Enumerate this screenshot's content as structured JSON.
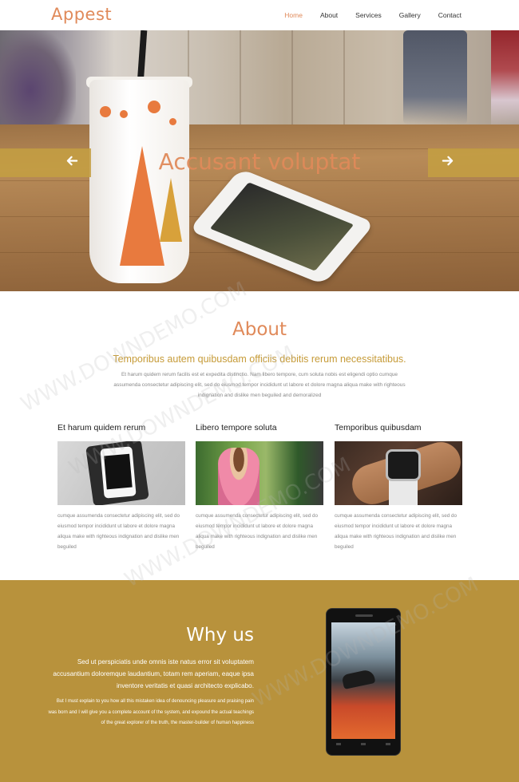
{
  "header": {
    "logo": "Appest",
    "nav": [
      {
        "label": "Home",
        "active": true
      },
      {
        "label": "About",
        "active": false
      },
      {
        "label": "Services",
        "active": false
      },
      {
        "label": "Gallery",
        "active": false
      },
      {
        "label": "Contact",
        "active": false
      }
    ]
  },
  "hero": {
    "title": "Accusant voluptat",
    "prev_icon": "arrow-left-icon",
    "next_icon": "arrow-right-icon"
  },
  "about": {
    "title": "About",
    "subtitle": "Temporibus autem quibusdam officiis debitis rerum necessitatibus.",
    "text": "Et harum quidem rerum facilis est et expedita distinctio. Nam libero tempore, cum soluta nobis est eligendi optio cumque assumenda consectetur adipiscing elit, sed do eiusmod tempor incididunt ut labore et dolore magna aliqua make with righteous indignation and dislike men beguiled and demoralized",
    "columns": [
      {
        "title": "Et harum quidem rerum",
        "text": "cumque assumenda consectetur adipiscing elit, sed do eiusmod tempor incididunt ut labore et dolore magna aliqua make with righteous indignation and dislike men beguiled"
      },
      {
        "title": "Libero tempore soluta",
        "text": "cumque assumenda consectetur adipiscing elit, sed do eiusmod tempor incididunt ut labore et dolore magna aliqua make with righteous indignation and dislike men beguiled"
      },
      {
        "title": "Temporibus quibusdam",
        "text": "cumque assumenda consectetur adipiscing elit, sed do eiusmod tempor incididunt ut labore et dolore magna aliqua make with righteous indignation and dislike men beguiled"
      }
    ]
  },
  "why": {
    "title": "Why us",
    "lead": "Sed ut perspiciatis unde omnis iste natus error sit voluptatem accusantium doloremque laudantium, totam rem aperiam, eaque ipsa inventore veritatis et quasi architecto explicabo.",
    "text": "But I must explain to you how all this mistaken idea of denouncing pleasure and praising pain was born and I will give you a complete account of the system, and expound the actual teachings of the great explorer of the truth, the master-builder of human happiness"
  },
  "watermarks": [
    "WWW.DOWNDEMO.COM",
    "WWW.DOWNDEMO.COM",
    "WWW.DOWNDEMO.COM",
    "WWW.DOWNDEMO.COM"
  ],
  "colors": {
    "accent": "#e08a5a",
    "gold": "#c69b38",
    "why_bg": "#b8923c",
    "arrow_bar": "#c49e42"
  }
}
